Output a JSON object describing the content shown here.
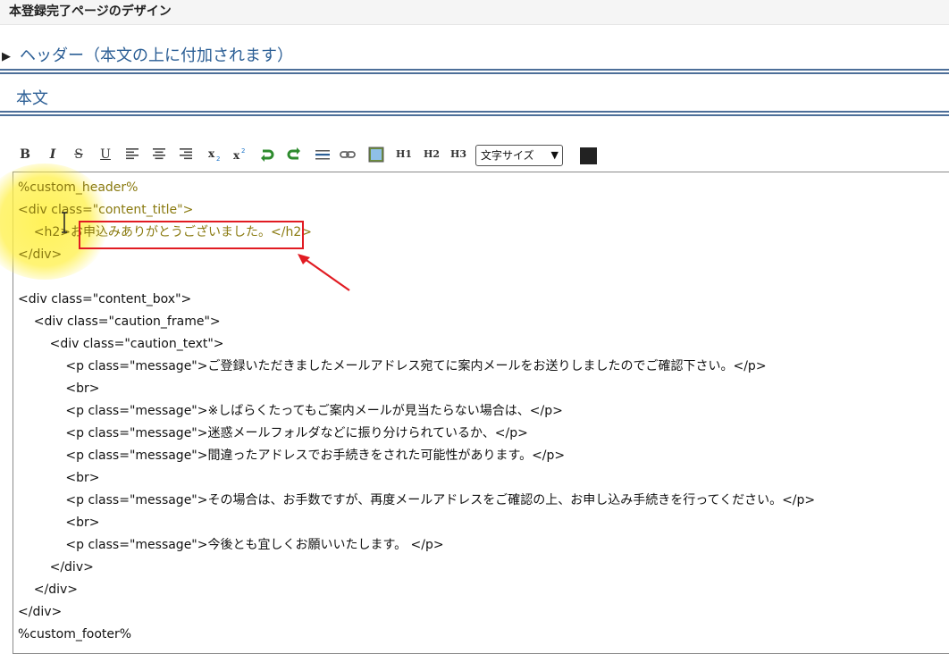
{
  "page": {
    "title": "本登録完了ページのデザイン"
  },
  "header_section": {
    "label": "ヘッダー（本文の上に付加されます）"
  },
  "body_section": {
    "label": "本文"
  },
  "toolbar": {
    "bold": "B",
    "italic": "I",
    "strike": "S",
    "underline": "U",
    "h1": "H1",
    "h2": "H2",
    "h3": "H3",
    "font_size_select": "文字サイズ",
    "text_color": "#222222"
  },
  "editor": {
    "lines": [
      "%custom_header%",
      "<div class=\"content_title\">",
      "    <h2>お申込みありがとうございました。</h2>",
      "</div>",
      "",
      "<div class=\"content_box\">",
      "    <div class=\"caution_frame\">",
      "        <div class=\"caution_text\">",
      "            <p class=\"message\">ご登録いただきましたメールアドレス宛てに案内メールをお送りしましたのでご確認下さい。</p>",
      "            <br>",
      "            <p class=\"message\">※しばらくたってもご案内メールが見当たらない場合は、</p>",
      "            <p class=\"message\">迷惑メールフォルダなどに振り分けられているか、</p>",
      "            <p class=\"message\">間違ったアドレスでお手続きをされた可能性があります。</p>",
      "            <br>",
      "            <p class=\"message\">その場合は、お手数ですが、再度メールアドレスをご確認の上、お申し込み手続きを行ってください。</p>",
      "            <br>",
      "            <p class=\"message\">今後とも宜しくお願いいたします。 </p>",
      "        </div>",
      "    </div>",
      "</div>",
      "%custom_footer%"
    ]
  },
  "colors": {
    "section_blue": "#2b5e95",
    "rule": "#4d6f99",
    "annotation_red": "#e11b22",
    "highlight": "#fff03c"
  }
}
